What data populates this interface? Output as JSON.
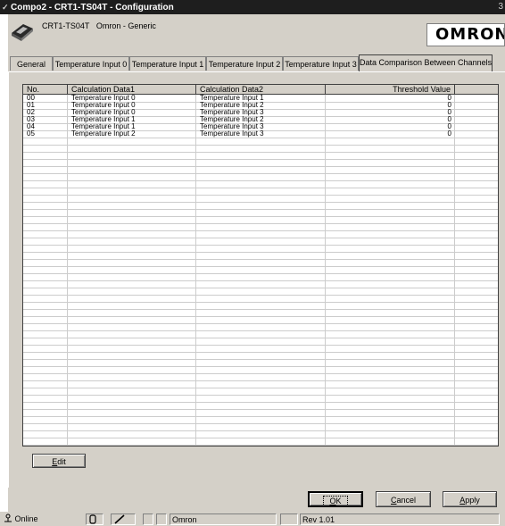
{
  "window": {
    "title": "Compo2 - CRT1-TS04T - Configuration",
    "edge_glyph": "3"
  },
  "device": {
    "model": "CRT1-TS04T",
    "vendor_line": "Omron - Generic",
    "logo_text": "OMRON",
    "icon": "device-module-icon"
  },
  "tabs": [
    {
      "label": "General"
    },
    {
      "label": "Temperature Input 0"
    },
    {
      "label": "Temperature Input 1"
    },
    {
      "label": "Temperature Input 2"
    },
    {
      "label": "Temperature Input 3"
    },
    {
      "label": "Data Comparison Between Channels",
      "active": true
    }
  ],
  "table": {
    "columns": [
      "No.",
      "Calculation Data1",
      "Calculation Data2",
      "Threshold Value"
    ],
    "rows": [
      [
        "00",
        "Temperature Input 0",
        "Temperature Input 1",
        "0"
      ],
      [
        "01",
        "Temperature Input 0",
        "Temperature Input 2",
        "0"
      ],
      [
        "02",
        "Temperature Input 0",
        "Temperature Input 3",
        "0"
      ],
      [
        "03",
        "Temperature Input 1",
        "Temperature Input 2",
        "0"
      ],
      [
        "04",
        "Temperature Input 1",
        "Temperature Input 3",
        "0"
      ],
      [
        "05",
        "Temperature Input 2",
        "Temperature Input 3",
        "0"
      ]
    ]
  },
  "buttons": {
    "edit_accel": "E",
    "edit_rest": "dit",
    "ok_accel": "O",
    "ok_rest": "K",
    "cancel_accel": "C",
    "cancel_rest": "ancel",
    "apply_accel": "A",
    "apply_rest": "pply"
  },
  "status": {
    "online": "Online",
    "online_icon": "network-icon",
    "vendor": "Omron",
    "rev": "Rev 1.01"
  }
}
